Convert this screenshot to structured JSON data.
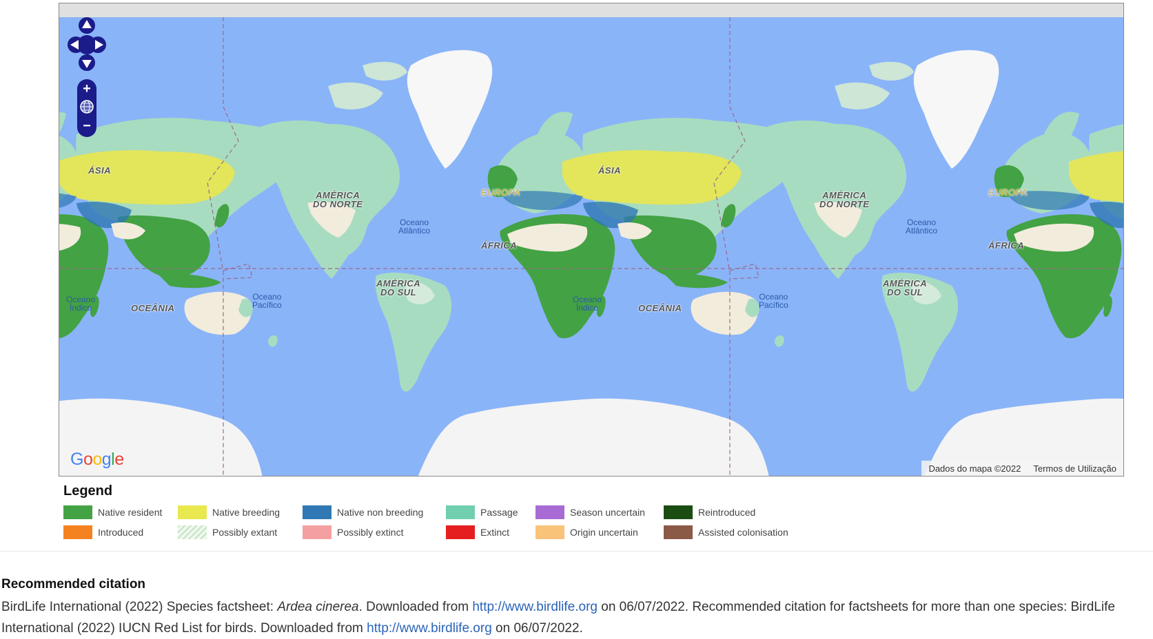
{
  "map": {
    "continent_labels": {
      "asia_left": "ÁSIA",
      "north_america_left": "AMÉRICA\nDO NORTE",
      "europe_mid": "EUROPA",
      "africa_mid": "ÁFRICA",
      "south_america_left": "AMÉRICA\nDO SUL",
      "oceania_left": "OCEÂNIA",
      "asia_mid": "ÁSIA",
      "oceania_mid": "OCEÂNIA",
      "north_america_right": "AMÉRICA\nDO NORTE",
      "south_america_right": "AMÉRICA\nDO SUL",
      "europe_right": "EUROPA",
      "africa_right": "ÁFRICA"
    },
    "ocean_labels": {
      "indian_left": "Oceano\nÍndico",
      "pacific_left": "Oceano\nPacífico",
      "atlantic_left": "Oceano\nAtlântico",
      "indian_mid": "Oceano\nÍndico",
      "pacific_right": "Oceano\nPacífico",
      "atlantic_right": "Oceano\nAtlântico"
    },
    "google_logo": "Google",
    "map_data_text": "Dados do mapa ©2022",
    "terms_text": "Termos de Utilização",
    "controls": {
      "pan_up_icon": "pan-up-icon",
      "zoom_in": "+",
      "zoom_out": "−"
    },
    "colors": {
      "ocean": "#8ab4f8",
      "land": "#a8dcc0",
      "desert": "#f2ecdc",
      "ice": "#f4f4f4",
      "native_resident": "#43a243",
      "native_breeding": "#e3e55a"
    }
  },
  "legend": {
    "title": "Legend",
    "items": [
      {
        "label": "Native resident",
        "color": "#43a243"
      },
      {
        "label": "Native breeding",
        "color": "#e9e84f"
      },
      {
        "label": "Native non breeding",
        "color": "#2f78b3"
      },
      {
        "label": "Passage",
        "color": "#6fcfae"
      },
      {
        "label": "Season uncertain",
        "color": "#a86bd3"
      },
      {
        "label": "Reintroduced",
        "color": "#1b4c12"
      },
      {
        "label": "Introduced",
        "color": "#f58220"
      },
      {
        "label": "Possibly extant",
        "color": "#d8ecd8"
      },
      {
        "label": "Possibly extinct",
        "color": "#f4a0a0"
      },
      {
        "label": "Extinct",
        "color": "#e51f1f"
      },
      {
        "label": "Origin uncertain",
        "color": "#f9c37a"
      },
      {
        "label": "Assisted colonisation",
        "color": "#8b5a47"
      }
    ]
  },
  "citation": {
    "title": "Recommended citation",
    "part1": "BirdLife International (2022) Species factsheet: ",
    "species": "Ardea cinerea",
    "part2": ". Downloaded from ",
    "link1": "http://www.birdlife.org",
    "part3": " on 06/07/2022. Recommended citation for factsheets for more than one species: BirdLife International (2022) IUCN Red List for birds. Downloaded from ",
    "link2": "http://www.birdlife.org",
    "part4": " on 06/07/2022."
  }
}
